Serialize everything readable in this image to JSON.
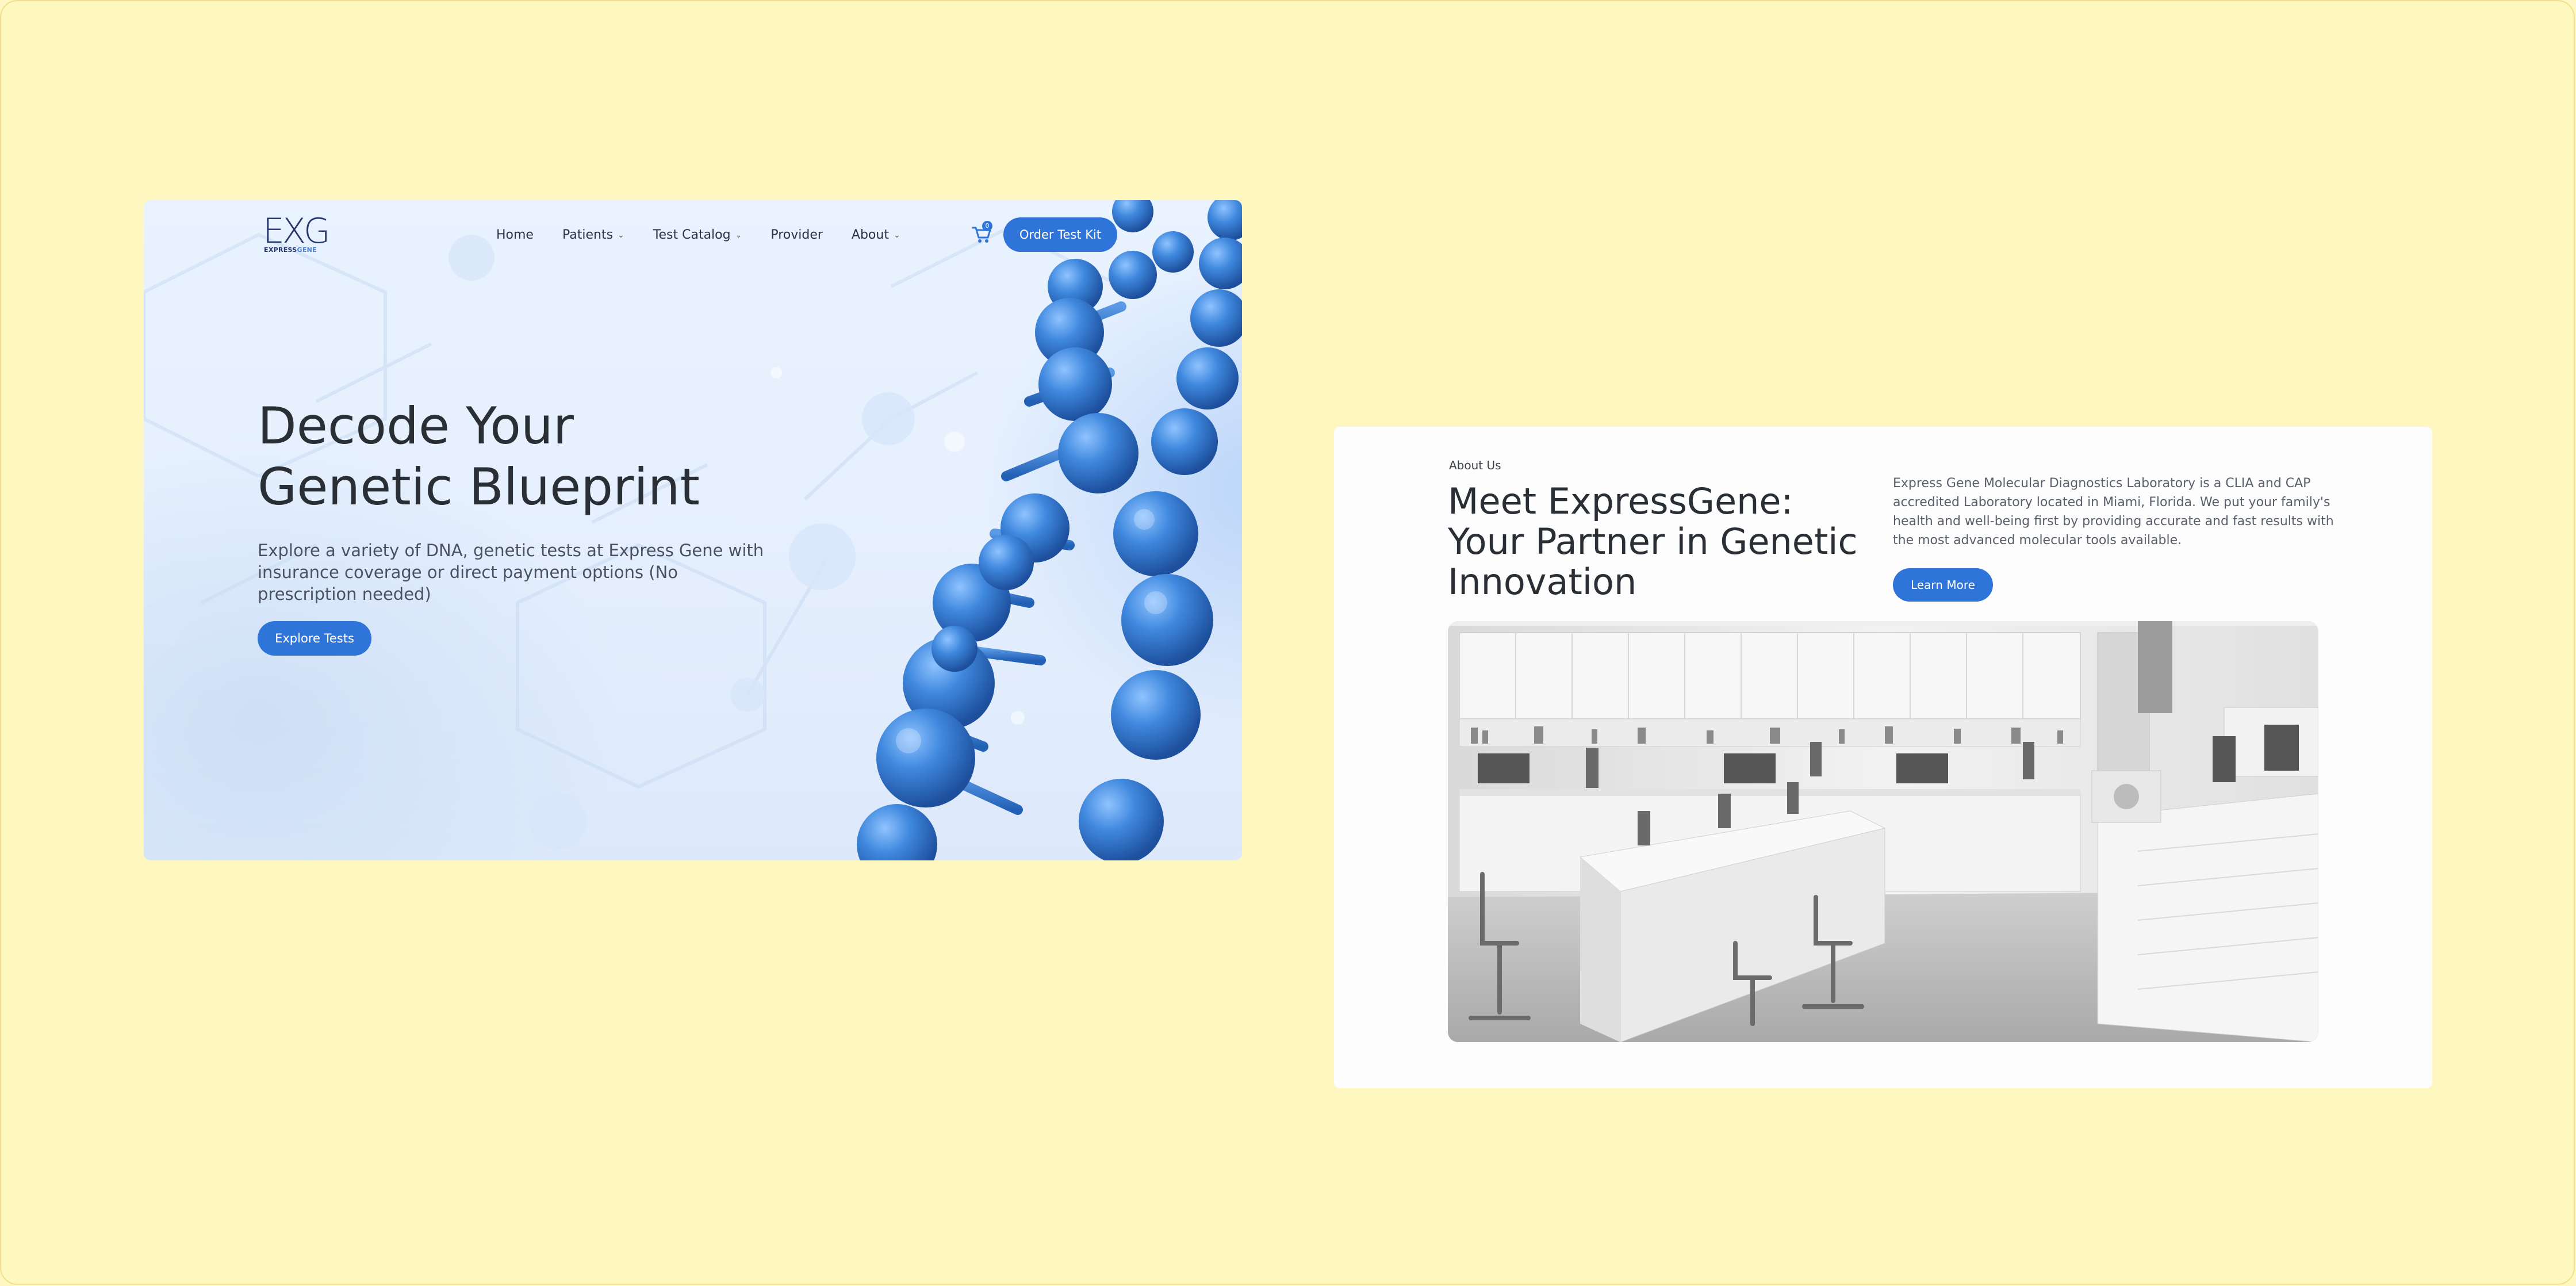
{
  "colors": {
    "background": "#fff7c0",
    "accent": "#2f74d8",
    "logo": "#27366f",
    "heading": "#2a2e35",
    "body_text": "#4b5160"
  },
  "hero": {
    "logo": {
      "mark": "EXG",
      "sub_express": "EXPRESS",
      "sub_gene": "GENE"
    },
    "nav": [
      {
        "label": "Home",
        "has_dropdown": false
      },
      {
        "label": "Patients",
        "has_dropdown": true
      },
      {
        "label": "Test Catalog",
        "has_dropdown": true
      },
      {
        "label": "Provider",
        "has_dropdown": false
      },
      {
        "label": "About",
        "has_dropdown": true
      }
    ],
    "cart": {
      "icon": "cart-icon",
      "count": "0"
    },
    "order_button": "Order Test Kit",
    "title_line1": "Decode Your",
    "title_line2": "Genetic Blueprint",
    "description": "Explore a variety of DNA, genetic tests at Express Gene with insurance coverage or direct payment options (No prescription needed)",
    "cta_button": "Explore Tests"
  },
  "about": {
    "eyebrow": "About Us",
    "title": "Meet ExpressGene: Your Partner in Genetic Innovation",
    "description": "Express Gene Molecular Diagnostics Laboratory is a CLIA and CAP accredited Laboratory located in Miami, Florida. We put your family's health and well-being first by providing accurate and fast results with the most advanced molecular tools available.",
    "cta_button": "Learn More"
  }
}
